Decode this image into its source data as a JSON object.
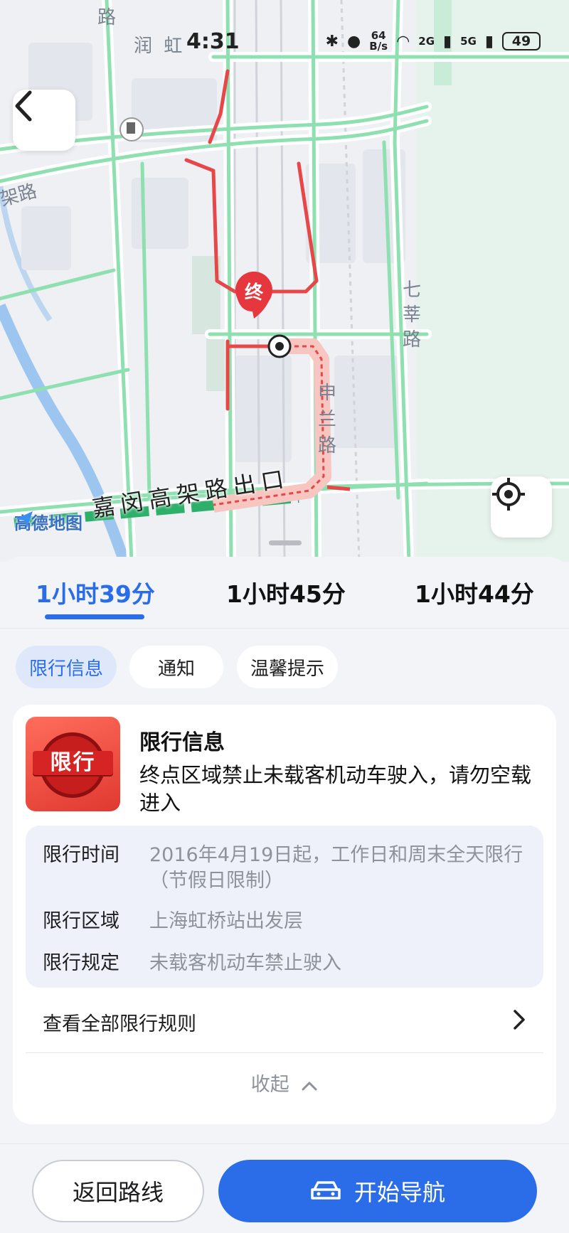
{
  "status_bar": {
    "time": "4:31",
    "net_speed_value": "64",
    "net_speed_unit": "B/s",
    "sim1": "2G",
    "sim2": "5G",
    "battery": "49"
  },
  "map": {
    "labels": {
      "road_top": "路",
      "runhong": "润 虹",
      "jia_road": "架路",
      "qixin_1": "七",
      "qixin_2": "莘",
      "qixin_3": "路",
      "shenlan_1": "申",
      "shenlan_2": "兰",
      "shenlan_3": "路",
      "highway": "嘉闵高架路出口"
    },
    "end_marker": "终",
    "watermark": "高德地图"
  },
  "route_tabs": [
    {
      "label": "1小时39分",
      "active": true
    },
    {
      "label": "1小时45分",
      "active": false
    },
    {
      "label": "1小时44分",
      "active": false
    }
  ],
  "chips": [
    {
      "label": "限行信息",
      "active": true
    },
    {
      "label": "通知",
      "active": false
    },
    {
      "label": "温馨提示",
      "active": false
    }
  ],
  "restriction_card": {
    "badge_text": "限行",
    "title": "限行信息",
    "description": "终点区域禁止未载客机动车驶入，请勿空载进入",
    "details": [
      {
        "key": "限行时间",
        "value": "2016年4月19日起，工作日和周末全天限行（节假日限制）"
      },
      {
        "key": "限行区域",
        "value": "上海虹桥站出发层"
      },
      {
        "key": "限行规定",
        "value": "未载客机动车禁止驶入"
      }
    ],
    "view_all": "查看全部限行规则",
    "collapse": "收起"
  },
  "bottom": {
    "back_label": "返回路线",
    "nav_label": "开始导航"
  },
  "colors": {
    "accent": "#2b6de8",
    "route_red": "#e8474a",
    "road_green": "#8fe0b0"
  }
}
